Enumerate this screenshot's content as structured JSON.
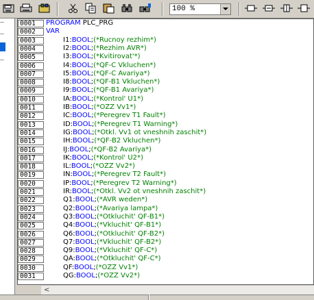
{
  "toolbar": {
    "buttons": [
      "save-icon",
      "print-icon",
      "library-icon",
      "cut-icon",
      "copy-icon",
      "paste-icon",
      "find-icon",
      "replace-icon"
    ],
    "zoom": "100 %",
    "right_buttons": [
      "box-icon",
      "network-icon",
      "insert-icon",
      "output-icon"
    ]
  },
  "editor": {
    "lines": [
      {
        "num": "0001",
        "indent": 0,
        "kw": "PROGRAM",
        "rest": " PLC_PRG",
        "comment": ""
      },
      {
        "num": "0002",
        "indent": 0,
        "kw": "VAR",
        "rest": "",
        "comment": ""
      },
      {
        "num": "0003",
        "indent": 1,
        "name": "I1",
        "type": "BOOL",
        "comment": "(*Rucnoy rezhim*)"
      },
      {
        "num": "0004",
        "indent": 1,
        "name": "I2",
        "type": "BOOL",
        "comment": "(*Rezhim AVR*)"
      },
      {
        "num": "0005",
        "indent": 1,
        "name": "I3",
        "type": "BOOL",
        "comment": "(*Kvitirovat'*)"
      },
      {
        "num": "0006",
        "indent": 1,
        "name": "I4",
        "type": "BOOL",
        "comment": "(*QF-C Vkluchen*)"
      },
      {
        "num": "0007",
        "indent": 1,
        "name": "I5",
        "type": "BOOL",
        "comment": "(*QF-C Avariya*)"
      },
      {
        "num": "0008",
        "indent": 1,
        "name": "I8",
        "type": "BOOL",
        "comment": "(*QF-B1 Vkluchen*)"
      },
      {
        "num": "0009",
        "indent": 1,
        "name": "I9",
        "type": "BOOL",
        "comment": "(*QF-B1 Avariya*)"
      },
      {
        "num": "0010",
        "indent": 1,
        "name": "IA",
        "type": "BOOL",
        "comment": "(*Kontrol' U1*)"
      },
      {
        "num": "0011",
        "indent": 1,
        "name": "IB",
        "type": "BOOL",
        "comment": "(*OZZ Vv1*)"
      },
      {
        "num": "0012",
        "indent": 1,
        "name": "IC",
        "type": "BOOL",
        "comment": "(*Peregrev T1 Fault*)"
      },
      {
        "num": "0013",
        "indent": 1,
        "name": "ID",
        "type": "BOOL",
        "comment": "(*Peregrev T1 Warning*)"
      },
      {
        "num": "0014",
        "indent": 1,
        "name": "IG",
        "type": "BOOL",
        "comment": "(*Otkl. Vv1 ot vneshnih zaschit*)"
      },
      {
        "num": "0015",
        "indent": 1,
        "name": "IH",
        "type": "BOOL",
        "comment": "(*QF-B2 Vkluchen*)"
      },
      {
        "num": "0016",
        "indent": 1,
        "name": "IJ",
        "type": "BOOL",
        "comment": "(*QF-B2 Avariya*)"
      },
      {
        "num": "0017",
        "indent": 1,
        "name": "IK",
        "type": "BOOL",
        "comment": "(*Kontrol' U2*)"
      },
      {
        "num": "0018",
        "indent": 1,
        "name": "IL",
        "type": "BOOL",
        "comment": "(*OZZ Vv2*)"
      },
      {
        "num": "0019",
        "indent": 1,
        "name": "IN",
        "type": "BOOL",
        "comment": "(*Peregrev T2 Fault*)"
      },
      {
        "num": "0020",
        "indent": 1,
        "name": "IP",
        "type": "BOOL",
        "comment": "(*Peregrev T2 Warning*)"
      },
      {
        "num": "0021",
        "indent": 1,
        "name": "IR",
        "type": "BOOL",
        "comment": "(*Otkl. Vv2 ot vneshnih zaschit*)"
      },
      {
        "num": "0022",
        "indent": 1,
        "name": "Q1",
        "type": "BOOL",
        "comment": "(*AVR weden*)"
      },
      {
        "num": "0023",
        "indent": 1,
        "name": "Q2",
        "type": "BOOL",
        "comment": "(*Avariya lampa*)"
      },
      {
        "num": "0024",
        "indent": 1,
        "name": "Q3",
        "type": "BOOL",
        "comment": "(*Otkluchit' QF-B1*)"
      },
      {
        "num": "0025",
        "indent": 1,
        "name": "Q4",
        "type": "BOOL",
        "comment": "(*Vkluchit' QF-B1*)"
      },
      {
        "num": "0026",
        "indent": 1,
        "name": "Q6",
        "type": "BOOL",
        "comment": "(*Otkluchit' QF-B2*)"
      },
      {
        "num": "0027",
        "indent": 1,
        "name": "Q7",
        "type": "BOOL",
        "comment": "(*Vkluchit' QF-B2*)"
      },
      {
        "num": "0028",
        "indent": 1,
        "name": "Q9",
        "type": "BOOL",
        "comment": "(*Vkluchit' QF-C*)"
      },
      {
        "num": "0029",
        "indent": 1,
        "name": "QA",
        "type": "BOOL",
        "comment": "(*Otkluchit' QF-C*)"
      },
      {
        "num": "0030",
        "indent": 1,
        "name": "QF",
        "type": "BOOL",
        "comment": "(*OZZ Vv1*)"
      },
      {
        "num": "0031",
        "indent": 1,
        "name": "QG",
        "type": "BOOL",
        "comment": "(*OZZ Vv2*)"
      }
    ]
  },
  "scrollbar": {
    "left_arrow": "<"
  },
  "colors": {
    "keyword": "#0000ff",
    "comment": "#008000",
    "selection": "#0a64d8"
  }
}
